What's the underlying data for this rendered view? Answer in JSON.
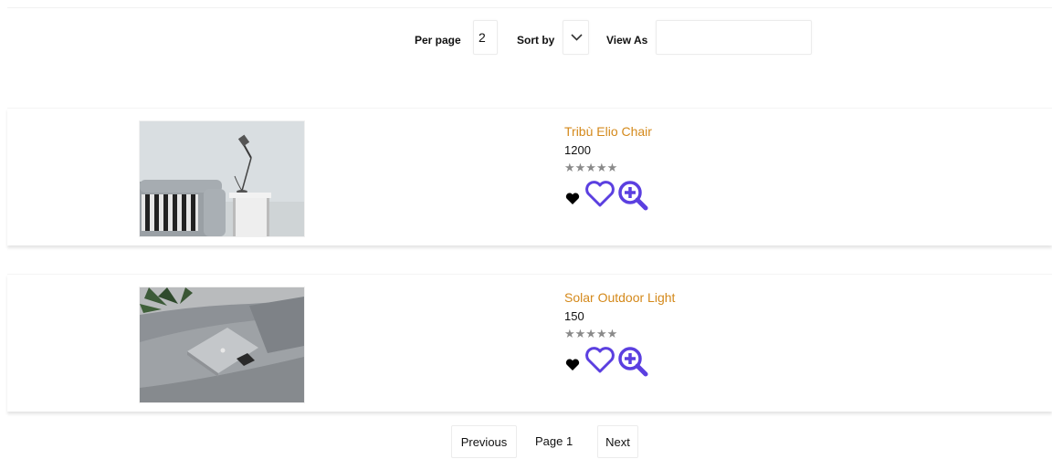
{
  "toolbar": {
    "per_page_label": "Per page",
    "per_page_value": "2",
    "sort_by_label": "Sort by",
    "view_as_label": "View As",
    "view_as_value": ""
  },
  "products": [
    {
      "name": "Tribù Elio Chair",
      "price": "1200",
      "rating_stars": "★★★★★",
      "image": "sofa-with-lamp-photo"
    },
    {
      "name": "Solar Outdoor Light",
      "price": "150",
      "rating_stars": "★★★★★",
      "image": "sofa-with-laptop-photo"
    }
  ],
  "pagination": {
    "previous_label": "Previous",
    "page_label": "Page 1",
    "next_label": "Next"
  },
  "colors": {
    "product_name": "#d4891b",
    "icon_accent": "#5b3fe0",
    "stars": "#8a8a8a"
  },
  "icons": [
    "chevron-down-icon",
    "heart-filled-icon",
    "heart-outline-icon",
    "zoom-in-icon"
  ]
}
